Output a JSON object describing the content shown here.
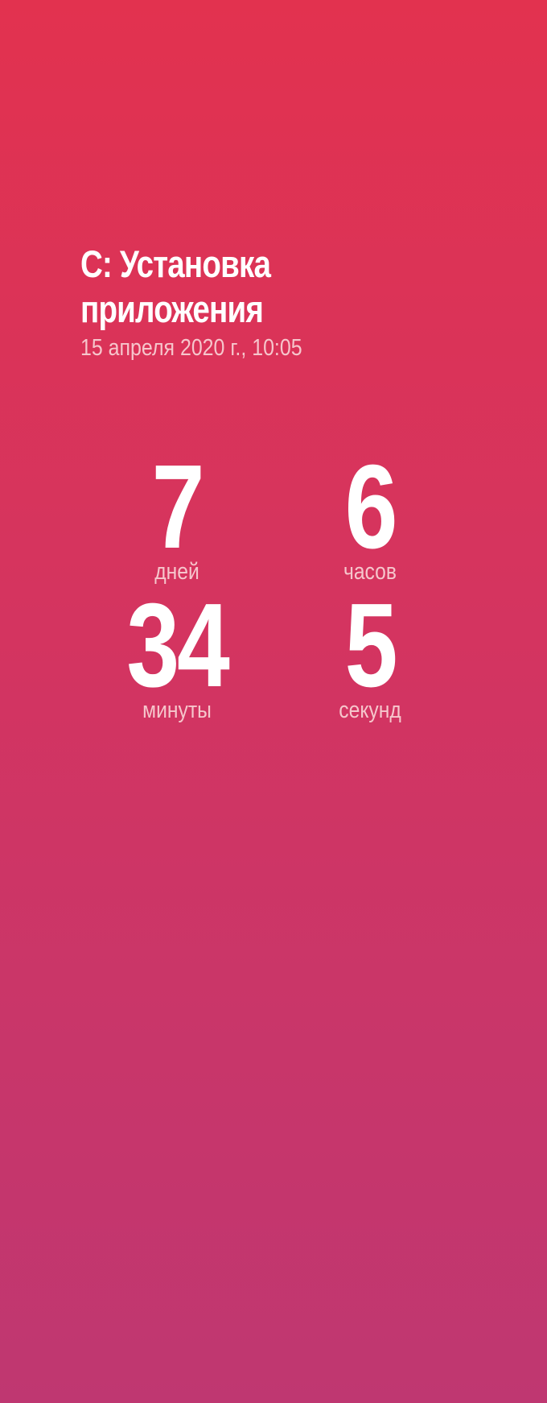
{
  "event": {
    "title_line1": "C: Установка",
    "title_line2": "приложения",
    "datetime": "15 апреля 2020 г., 10:05"
  },
  "countdown": {
    "days": {
      "value": "7",
      "label": "дней"
    },
    "hours": {
      "value": "6",
      "label": "часов"
    },
    "minutes": {
      "value": "34",
      "label": "минуты"
    },
    "seconds": {
      "value": "5",
      "label": "секунд"
    }
  },
  "colors": {
    "background_top": "#e2324f",
    "background_bottom": "#bf3771",
    "text_primary": "#ffffff",
    "text_secondary": "#f6c6cc"
  }
}
